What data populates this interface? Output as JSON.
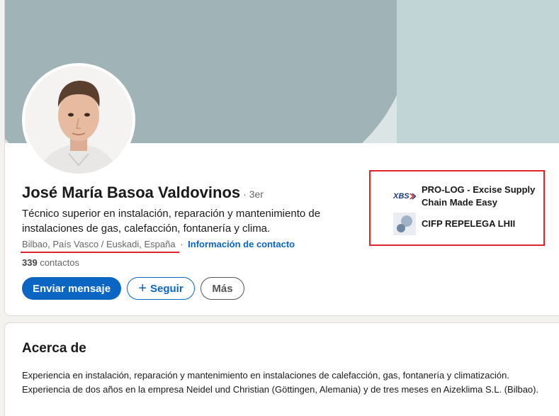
{
  "profile": {
    "name": "José María Basoa Valdovinos",
    "degree": "· 3er",
    "headline": "Técnico superior en instalación, reparación y mantenimiento de instalaciones de gas, calefacción, fontanería y clima.",
    "location": "Bilbao, País Vasco / Euskadi, España",
    "location_separator": "·",
    "contact_info_label": "Información de contacto",
    "connections_count": "339",
    "connections_label": "contactos",
    "avatar_icon": "profile-photo"
  },
  "actions": {
    "message_label": "Enviar mensaje",
    "follow_plus": "+",
    "follow_label": "Seguir",
    "more_label": "Más"
  },
  "companies": [
    {
      "logo_text": "XBS",
      "logo_icon": "xbs-logo",
      "name": "PRO-LOG - Excise Supply Chain Made Easy"
    },
    {
      "logo_icon": "school-logo",
      "name": "CIFP REPELEGA LHII"
    }
  ],
  "about": {
    "title": "Acerca de",
    "text": "Experiencia en instalación, reparación y mantenimiento en instalaciones de calefacción, gas, fontanería y climatización. Experiencia de dos años en la empresa Neidel und Christian (Göttingen, Alemania) y de tres meses en Aizeklima S.L. (Bilbao)."
  },
  "colors": {
    "accent": "#0a66c2",
    "highlight_red": "#e0262c",
    "banner_light": "#dce5e6",
    "banner_dark": "#a0b4b8",
    "banner_panel": "#c1d4d6"
  }
}
